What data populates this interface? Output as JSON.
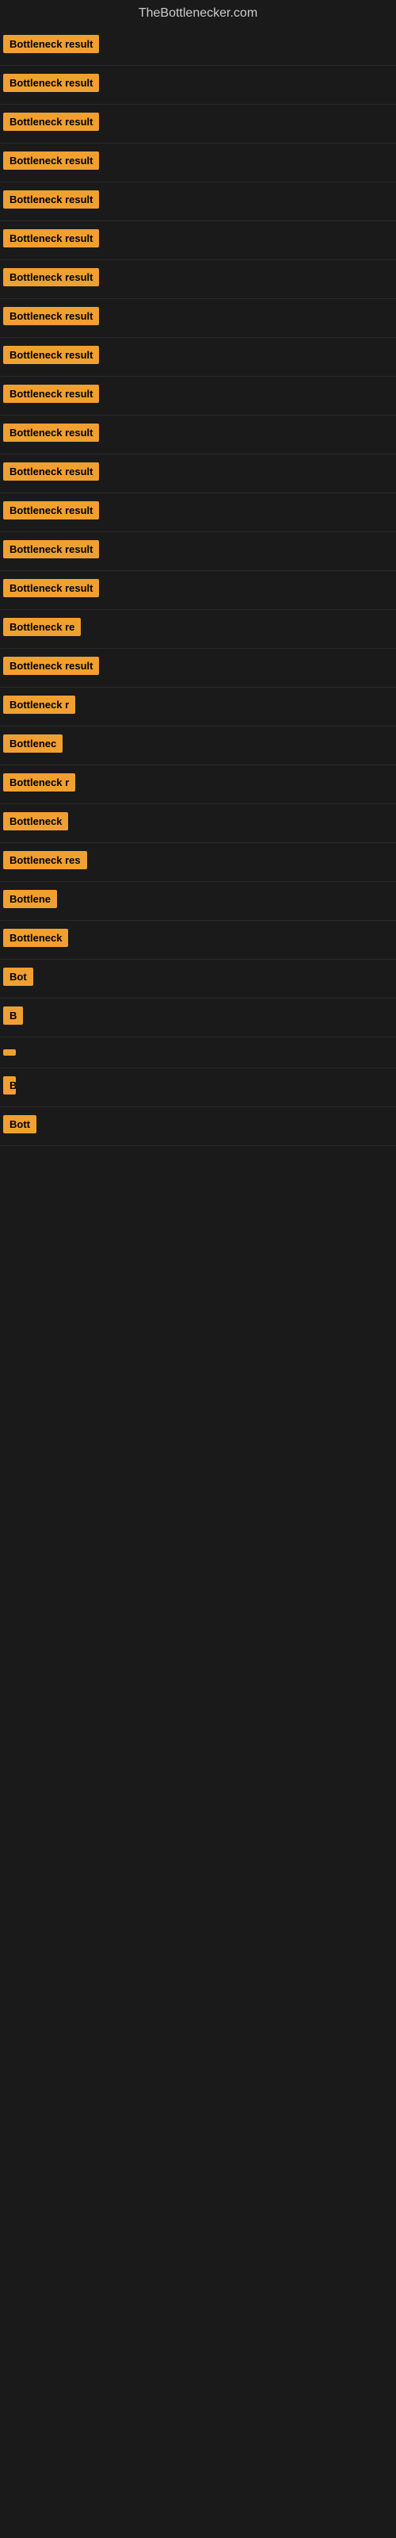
{
  "site": {
    "title": "TheBottlenecker.com"
  },
  "items": [
    {
      "id": 1,
      "label": "Bottleneck result",
      "width_class": "w-full"
    },
    {
      "id": 2,
      "label": "Bottleneck result",
      "width_class": "w-full"
    },
    {
      "id": 3,
      "label": "Bottleneck result",
      "width_class": "w-full"
    },
    {
      "id": 4,
      "label": "Bottleneck result",
      "width_class": "w-full"
    },
    {
      "id": 5,
      "label": "Bottleneck result",
      "width_class": "w-full"
    },
    {
      "id": 6,
      "label": "Bottleneck result",
      "width_class": "w-full"
    },
    {
      "id": 7,
      "label": "Bottleneck result",
      "width_class": "w-full"
    },
    {
      "id": 8,
      "label": "Bottleneck result",
      "width_class": "w-full"
    },
    {
      "id": 9,
      "label": "Bottleneck result",
      "width_class": "w-full"
    },
    {
      "id": 10,
      "label": "Bottleneck result",
      "width_class": "w-full"
    },
    {
      "id": 11,
      "label": "Bottleneck result",
      "width_class": "w-full"
    },
    {
      "id": 12,
      "label": "Bottleneck result",
      "width_class": "w-full"
    },
    {
      "id": 13,
      "label": "Bottleneck result",
      "width_class": "w-full"
    },
    {
      "id": 14,
      "label": "Bottleneck result",
      "width_class": "w-full"
    },
    {
      "id": 15,
      "label": "Bottleneck result",
      "width_class": "w-full"
    },
    {
      "id": 16,
      "label": "Bottleneck re",
      "width_class": "w-large"
    },
    {
      "id": 17,
      "label": "Bottleneck result",
      "width_class": "w-full"
    },
    {
      "id": 18,
      "label": "Bottleneck r",
      "width_class": "w-medium"
    },
    {
      "id": 19,
      "label": "Bottlenec",
      "width_class": "w-medium"
    },
    {
      "id": 20,
      "label": "Bottleneck r",
      "width_class": "w-medium"
    },
    {
      "id": 21,
      "label": "Bottleneck",
      "width_class": "w-small"
    },
    {
      "id": 22,
      "label": "Bottleneck res",
      "width_class": "w-large"
    },
    {
      "id": 23,
      "label": "Bottlene",
      "width_class": "w-small"
    },
    {
      "id": 24,
      "label": "Bottleneck",
      "width_class": "w-small"
    },
    {
      "id": 25,
      "label": "Bot",
      "width_class": "w-xsmall"
    },
    {
      "id": 26,
      "label": "B",
      "width_class": "w-tiny"
    },
    {
      "id": 27,
      "label": "",
      "width_class": "w-micro"
    },
    {
      "id": 28,
      "label": "B",
      "width_class": "w-nano"
    },
    {
      "id": 29,
      "label": "Bott",
      "width_class": "w-xsmall"
    }
  ]
}
